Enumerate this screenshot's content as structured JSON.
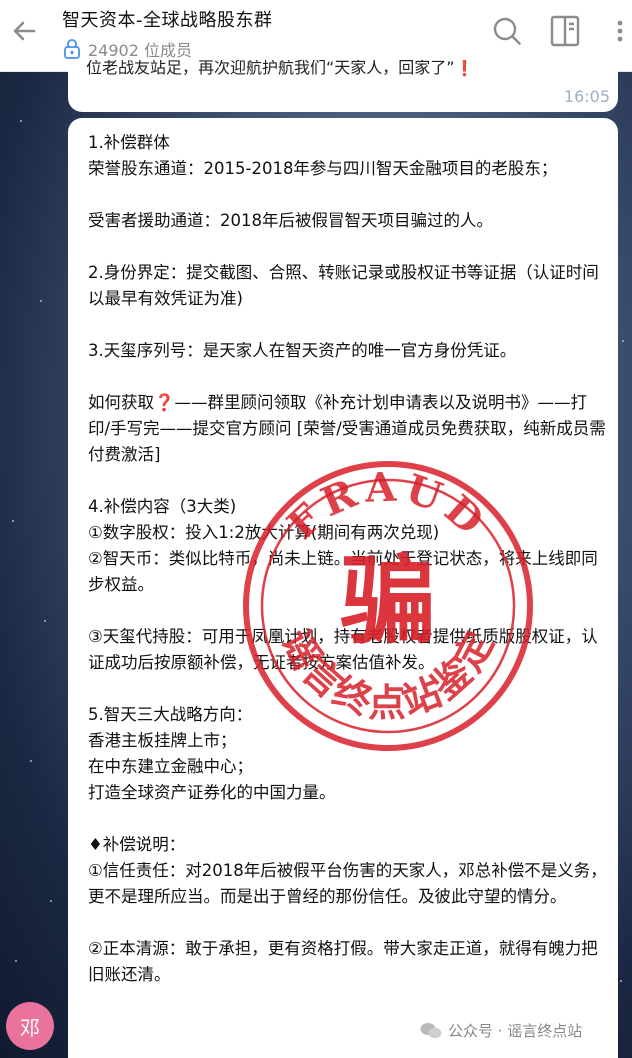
{
  "header": {
    "title": "智天资本-全球战略股东群",
    "members": "24902 位成员"
  },
  "prev_message": {
    "partial_text": "位老战友站足，再次迎航护航我们“天家人，回家了”❗",
    "time": "16:05"
  },
  "message": {
    "lines": [
      "1.补偿群体",
      "荣誉股东通道：2015-2018年参与四川智天金融项目的老股东；",
      "",
      "受害者援助通道：2018年后被假冒智天项目骗过的人。",
      "",
      "2.身份界定：提交截图、合照、转账记录或股权证书等证据（认证时间以最早有效凭证为准)",
      "",
      "3.天玺序列号：是天家人在智天资产的唯一官方身份凭证。",
      "",
      "如何获取❓——群里顾问领取《补充计划申请表以及说明书》——打印/手写完——提交官方顾问 [荣誉/受害通道成员免费获取，纯新成员需付费激活]",
      "",
      "4.补偿内容（3大类)",
      "①数字股权：投入1:2放大计算(期间有两次兑现)",
      "②智天币：类似比特币，尚未上链。当前处于登记状态，将来上线即同步权益。",
      "",
      "③天玺代持股：可用于凤凰计划，持有老股权者提供纸质版股权证，认证成功后按原额补偿，无证者按方案估值补发。",
      "",
      "5.智天三大战略方向：",
      "香港主板挂牌上市；",
      "在中东建立金融中心；",
      "打造全球资产证券化的中国力量。",
      "",
      "♦补偿说明：",
      "①信任责任：对2018年后被假平台伤害的天家人，邓总补偿不是义务，更不是理所应当。而是出于曾经的那份信任。及彼此守望的情分。",
      "",
      "②正本清源：敢于承担，更有资格打假。带大家走正道，就得有魄力把旧账还清。"
    ]
  },
  "stamp": {
    "top_text": "FRAUD",
    "center_char": "骗",
    "bottom_text": "谣言终点站鉴定",
    "color": "#d8202a"
  },
  "avatar": {
    "initial": "邓",
    "color": "#e9739c"
  },
  "watermark": {
    "text": "公众号 · 谣言终点站",
    "time": "16:05"
  }
}
